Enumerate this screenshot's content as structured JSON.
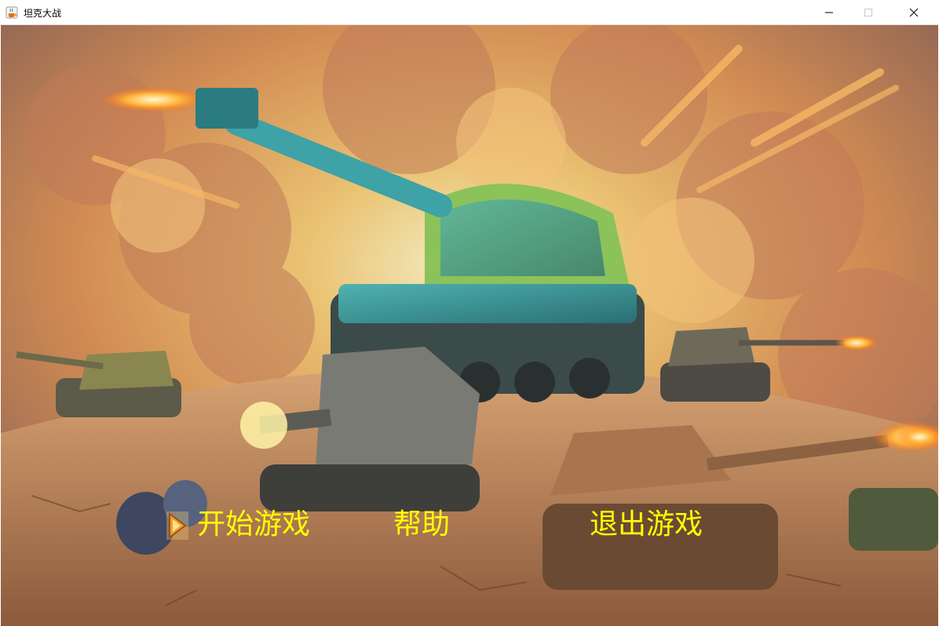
{
  "window": {
    "title": "坦克大战"
  },
  "menu": {
    "items": [
      {
        "label": "开始游戏"
      },
      {
        "label": "帮助"
      },
      {
        "label": "退出游戏"
      }
    ],
    "selected_index": 0
  },
  "colors": {
    "menu_text": "#FFFF00",
    "selector_fill": "#F0A030",
    "selector_border": "#A05010",
    "sky_blue": "#5A9FD0",
    "smoke_orange": "#E8954A",
    "ground": "#C9976A"
  },
  "icons": {
    "app": "java-coffee-icon",
    "selector": "triangle-right-icon",
    "minimize": "minimize-icon",
    "maximize": "maximize-icon",
    "close": "close-icon"
  }
}
